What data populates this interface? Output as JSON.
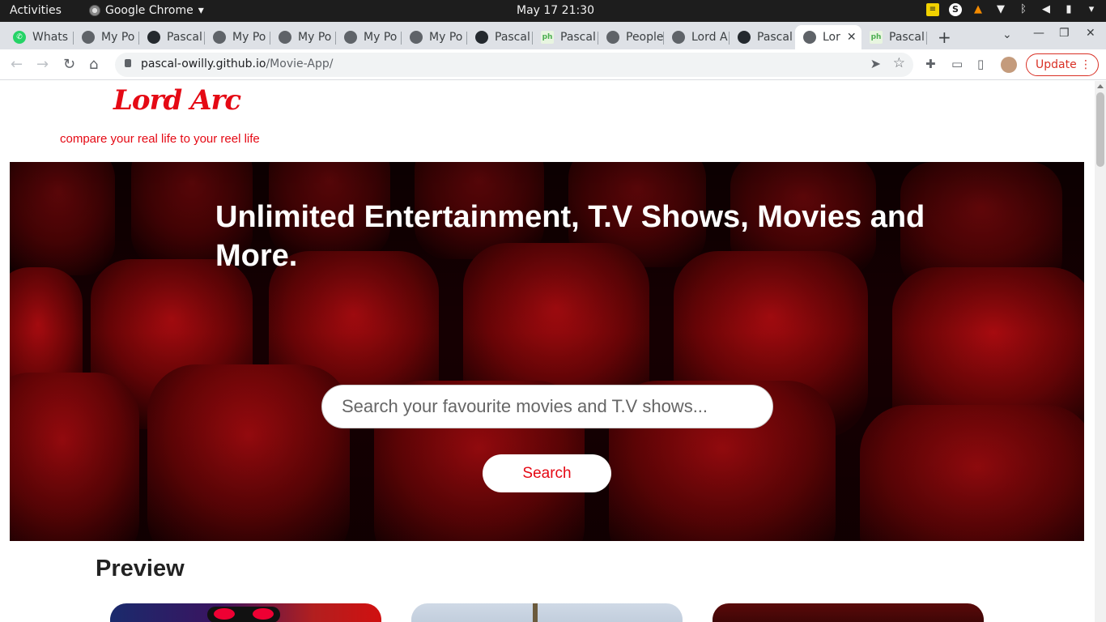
{
  "system_bar": {
    "activities": "Activities",
    "app_name": "Google Chrome",
    "clock": "May 17  21:30"
  },
  "tabs": [
    {
      "label": "Whats",
      "icon": "whatsapp-icon"
    },
    {
      "label": "My Po",
      "icon": "globe-icon"
    },
    {
      "label": "Pascal",
      "icon": "github-icon"
    },
    {
      "label": "My Po",
      "icon": "globe-icon"
    },
    {
      "label": "My Po",
      "icon": "globe-icon"
    },
    {
      "label": "My Po",
      "icon": "globe-icon"
    },
    {
      "label": "My Po",
      "icon": "globe-icon"
    },
    {
      "label": "Pascal",
      "icon": "github-icon"
    },
    {
      "label": "Pascal",
      "icon": "ph-icon"
    },
    {
      "label": "People",
      "icon": "globe-icon"
    },
    {
      "label": "Lord A",
      "icon": "globe-icon"
    },
    {
      "label": "Pascal",
      "icon": "github-icon"
    },
    {
      "label": "Lor",
      "icon": "globe-icon",
      "active": true
    },
    {
      "label": "Pascal",
      "icon": "ph-icon"
    }
  ],
  "toolbar": {
    "url_host": "pascal-owilly.github.io",
    "url_path": "/Movie-App/",
    "update_label": "Update"
  },
  "page": {
    "logo": "Lord Arc",
    "tagline": "compare your real life to your reel life",
    "hero_title": "Unlimited Entertainment, T.V Shows, Movies and More.",
    "search_placeholder": "Search your favourite movies and T.V shows...",
    "search_button": "Search",
    "preview_heading": "Preview"
  },
  "colors": {
    "brand_red": "#e50914",
    "hero_dark": "#2a0003"
  }
}
